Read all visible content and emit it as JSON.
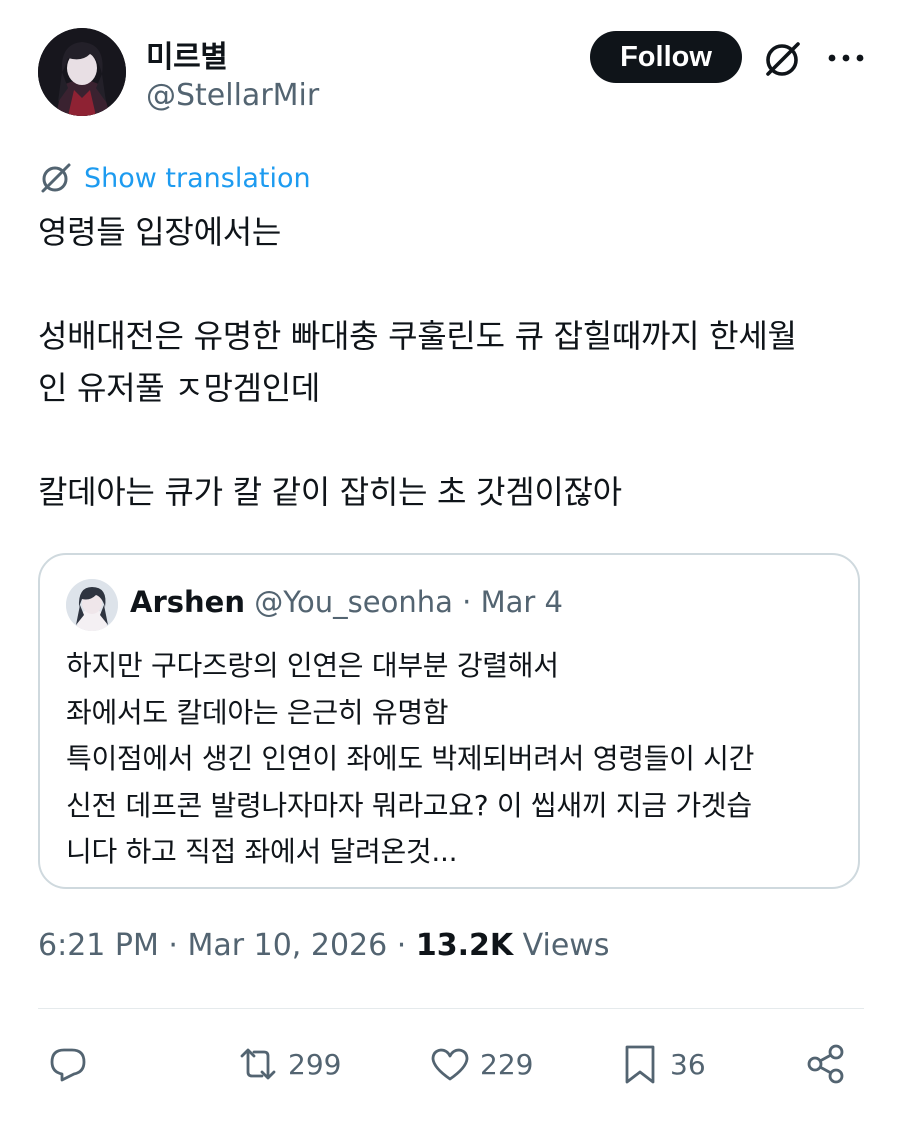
{
  "author": {
    "display_name": "미르별",
    "handle": "@StellarMir"
  },
  "follow_label": "Follow",
  "translation_label": "Show translation",
  "tweet_text": "영령들 입장에서는\n\n성배대전은 유명한 빠대충 쿠훌린도 큐 잡힐때까지 한세월\n인 유저풀 ㅈ망겜인데\n\n칼데아는 큐가 칼 같이 잡히는 초 갓겜이잖아",
  "quote": {
    "name": "Arshen",
    "handle": "@You_seonha",
    "separator": " · ",
    "date": "Mar 4",
    "text": "하지만 구다즈랑의 인연은 대부분 강렬해서\n좌에서도 칼데아는 은근히 유명함\n특이점에서 생긴 인연이 좌에도 박제되버려서 영령들이 시간\n신전 데프콘 발령나자마자 뭐라고요? 이 씹새끼 지금 가겟습\n니다 하고 직접 좌에서 달려온것..."
  },
  "meta": {
    "time": "6:21 PM",
    "sep1": " · ",
    "date": "Mar 10, 2026",
    "sep2": " · ",
    "views_count": "13.2K",
    "views_label": " Views"
  },
  "actions": {
    "reply_icon": "reply-icon",
    "retweets": "299",
    "likes": "229",
    "bookmarks": "36",
    "share_icon": "share-icon"
  },
  "colors": {
    "text": "#0f1419",
    "secondary": "#536471",
    "link": "#1d9bf0",
    "border": "#cfd9de",
    "avatar_bg": "#1b1b22"
  }
}
